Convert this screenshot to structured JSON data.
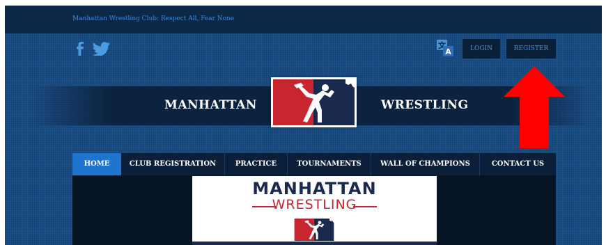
{
  "header": {
    "tagline": "Manhattan Wrestling Club: Respect All, Fear None",
    "login_label": "LOGIN",
    "register_label": "REGISTER",
    "social_icons": [
      "facebook-icon",
      "twitter-icon"
    ],
    "language_icon": "translate-icon"
  },
  "brand": {
    "left_word": "MANHATTAN",
    "right_word": "WRESTLING",
    "colors": {
      "red": "#c8262f",
      "navy": "#1a2a4f",
      "accent_blue": "#1f74cf"
    }
  },
  "nav": {
    "items": [
      {
        "label": "HOME",
        "active": true
      },
      {
        "label": "CLUB REGISTRATION"
      },
      {
        "label": "PRACTICE"
      },
      {
        "label": "TOURNAMENTS"
      },
      {
        "label": "WALL OF CHAMPIONS"
      },
      {
        "label": "CONTACT US"
      }
    ]
  },
  "banner": {
    "title": "MANHATTAN",
    "subtitle": "WRESTLING"
  },
  "annotation": {
    "arrow_color": "#ff0000"
  }
}
